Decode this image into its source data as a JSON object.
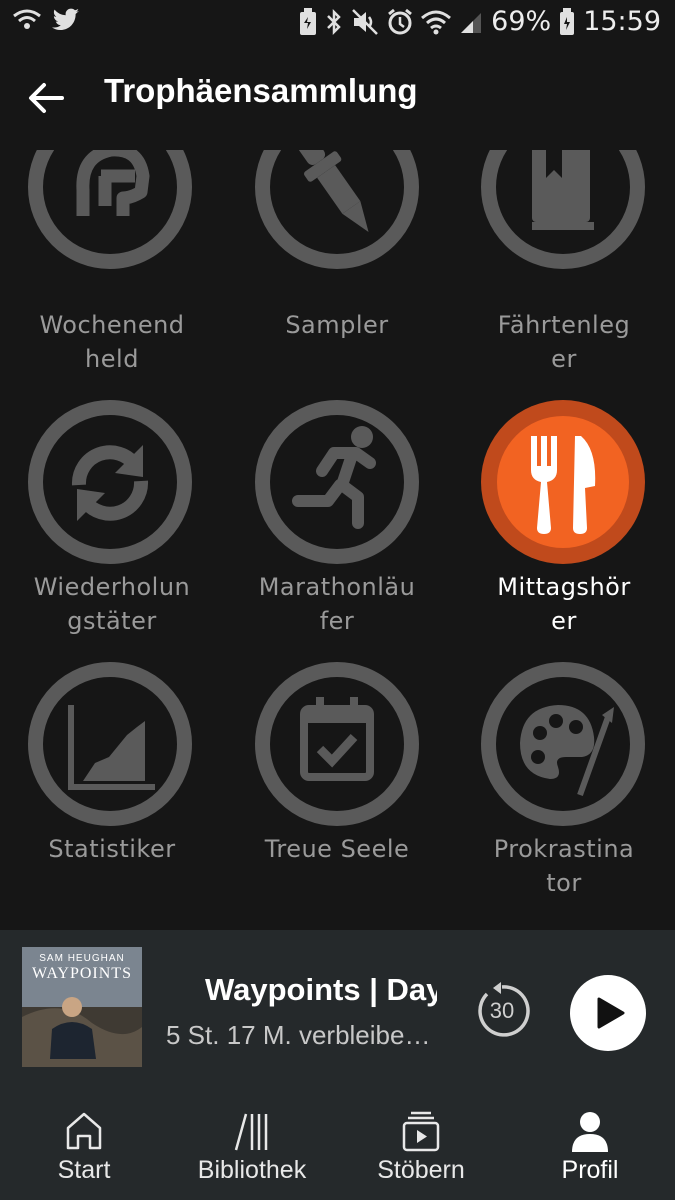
{
  "status_bar": {
    "battery": "69%",
    "time": "15:59"
  },
  "header": {
    "title": "Trophäensammlung"
  },
  "trophies": [
    {
      "label": "Wochenend\nheld",
      "icon": "spartan-helmet-icon",
      "unlocked": false
    },
    {
      "label": "Sampler",
      "icon": "dropper-icon",
      "unlocked": false
    },
    {
      "label": "Fährtenleg\ner",
      "icon": "book-bookmark-icon",
      "unlocked": false
    },
    {
      "label": "Wiederholun\ngstäter",
      "icon": "repeat-icon",
      "unlocked": false
    },
    {
      "label": "Marathonläu\nfer",
      "icon": "runner-icon",
      "unlocked": false
    },
    {
      "label": "Mittagshör\ner",
      "icon": "fork-knife-icon",
      "unlocked": true
    },
    {
      "label": "Statistiker",
      "icon": "area-chart-icon",
      "unlocked": false
    },
    {
      "label": "Treue Seele",
      "icon": "calendar-check-icon",
      "unlocked": false
    },
    {
      "label": "Prokrastina\ntor",
      "icon": "palette-icon",
      "unlocked": false
    }
  ],
  "player": {
    "cover_author": "SAM HEUGHAN",
    "cover_title": "WAYPOINTS",
    "title": "Waypoints | Day",
    "subtitle": "5 St. 17 M. verbleibe…",
    "skip_seconds": "30"
  },
  "nav": [
    {
      "label": "Start",
      "icon": "home-icon",
      "active": false
    },
    {
      "label": "Bibliothek",
      "icon": "library-icon",
      "active": false
    },
    {
      "label": "Stöbern",
      "icon": "browse-icon",
      "active": false
    },
    {
      "label": "Profil",
      "icon": "profile-icon",
      "active": true
    }
  ],
  "colors": {
    "accent": "#f26322",
    "accent_dark": "#c04a1c",
    "locked": "#5a5a5a",
    "background": "#161616",
    "bar": "#25292b"
  }
}
